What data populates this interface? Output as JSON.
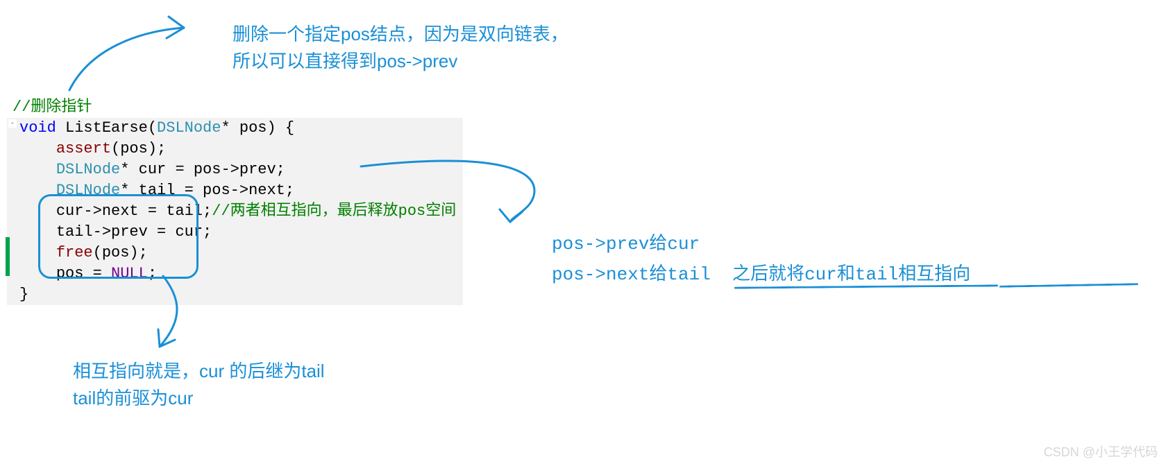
{
  "topAnnotation": {
    "line1": "删除一个指定pos结点，因为是双向链表，",
    "line2": "所以可以直接得到pos->prev"
  },
  "rightNote": {
    "line1": "pos->prev给cur",
    "line2": "pos->next给tail",
    "extra": "之后就将cur和tail相互指向"
  },
  "bottomAnnotation": {
    "line1": "相互指向就是，cur 的后继为tail",
    "line2": "tail的前驱为cur"
  },
  "code": {
    "commentTop": "//删除指针",
    "sigKw": "void",
    "sigName": " ListEarse",
    "sigParam": "(",
    "sigType": "DSLNode",
    "sigAfter": "* pos) {",
    "assertCall": "assert",
    "assertArgs": "(pos);",
    "curDeclType": "DSLNode",
    "curDeclRest": "* cur = pos->prev;",
    "tailDeclType": "DSLNode",
    "tailDeclRest": "* tail = pos->next;",
    "curNext": "cur->next = tail;",
    "inlineComment": "//两者相互指向，最后释放pos空间",
    "tailPrev": "tail->prev = cur;",
    "freeCall": "free",
    "freeArgs": "(pos);",
    "posAssign1": "pos = ",
    "posNull": "NULL",
    "posAssign2": ";",
    "closeBrace": "}"
  },
  "watermark": "CSDN @小王学代码"
}
